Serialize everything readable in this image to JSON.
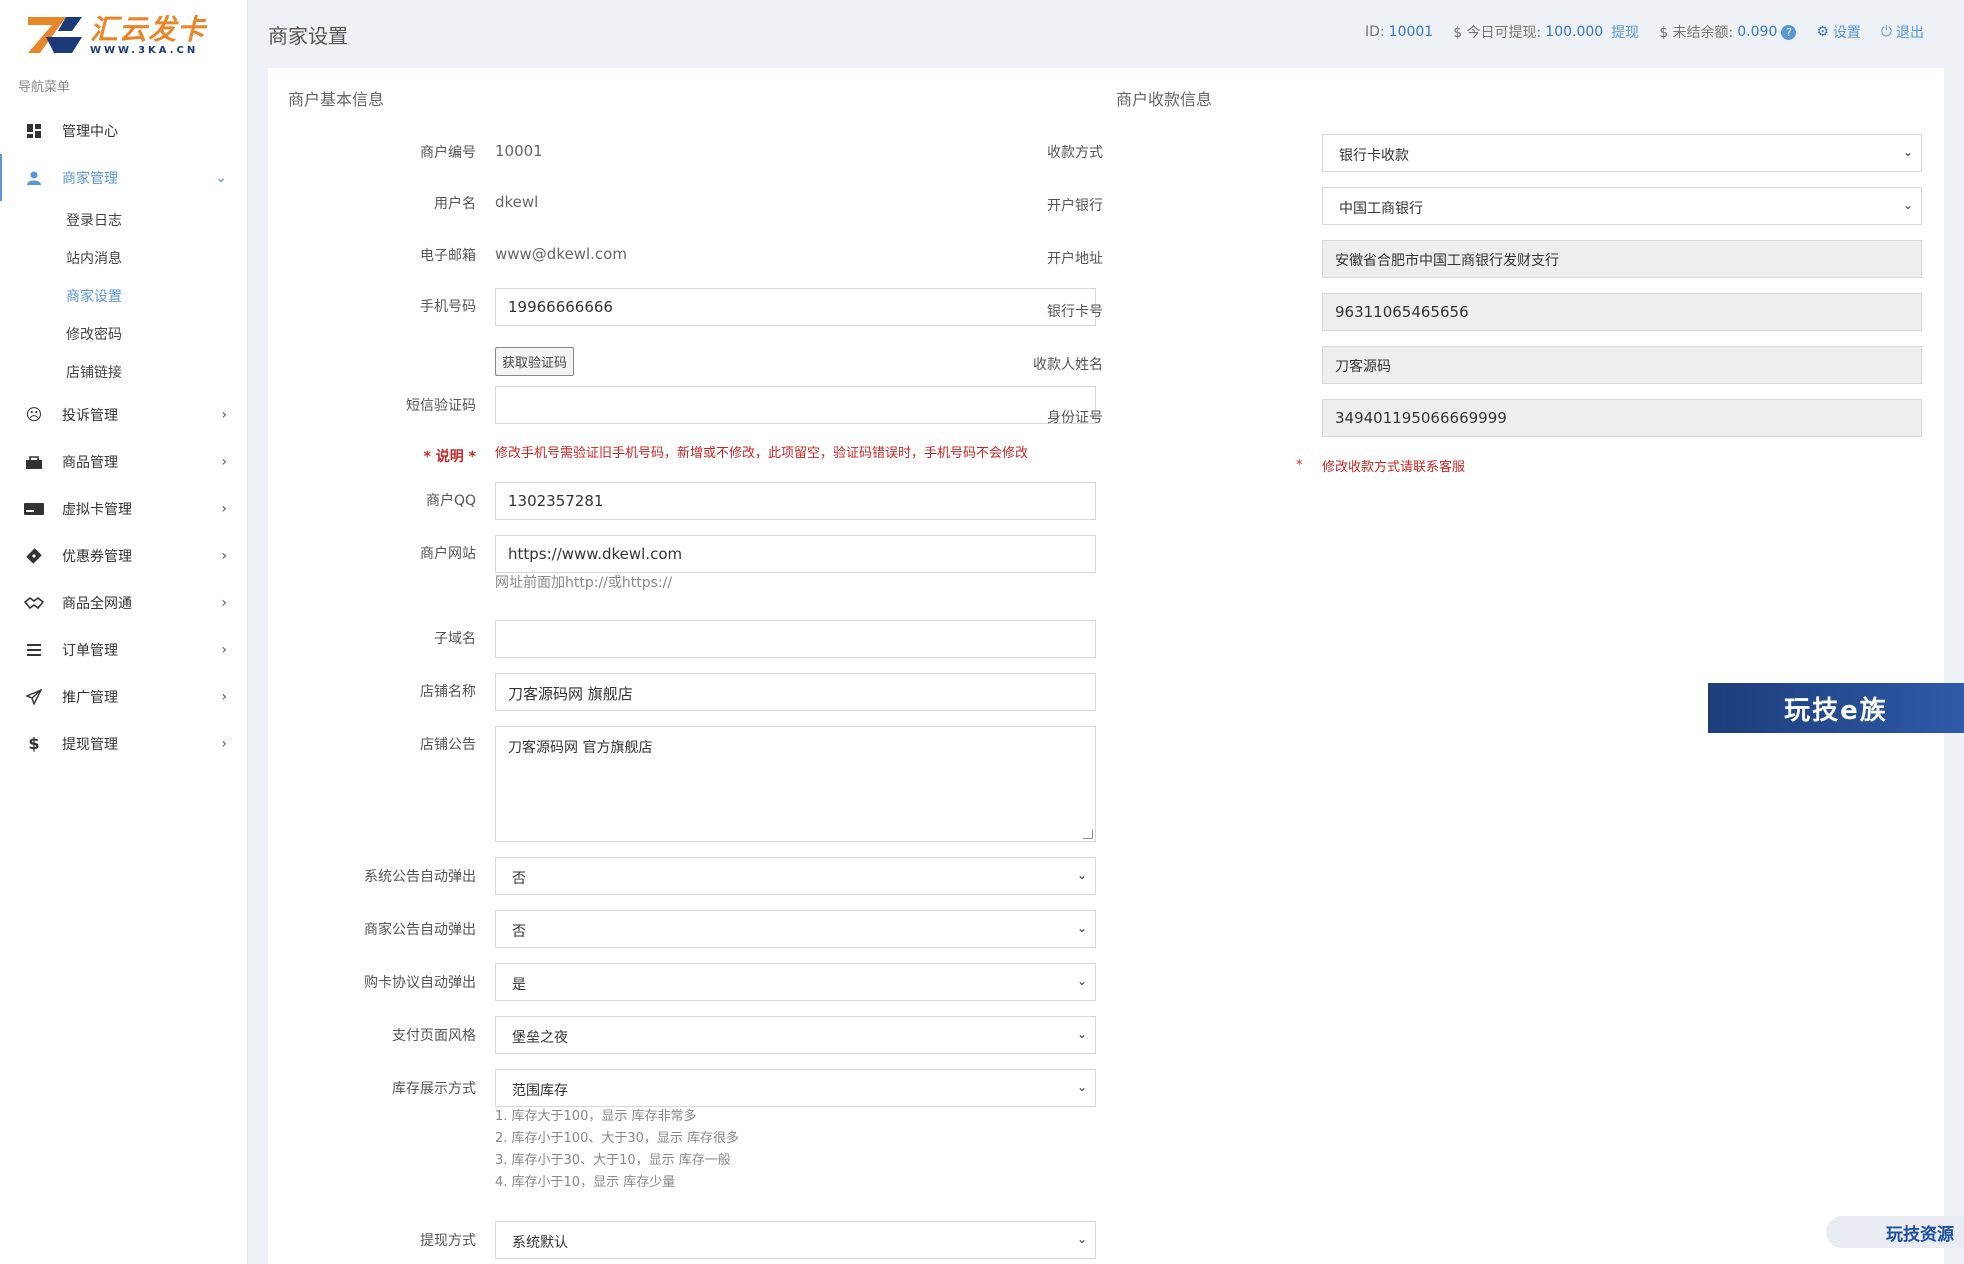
{
  "brand": {
    "title": "汇云发卡",
    "subtitle": "WWW.3KA.CN"
  },
  "sidebar": {
    "caption": "导航菜单",
    "items": [
      {
        "label": "管理中心",
        "icon": "dashboard-icon"
      },
      {
        "label": "商家管理",
        "icon": "user-icon",
        "active": true
      },
      {
        "label": "投诉管理",
        "icon": "frown-icon"
      },
      {
        "label": "商品管理",
        "icon": "bag-icon"
      },
      {
        "label": "虚拟卡管理",
        "icon": "card-icon"
      },
      {
        "label": "优惠券管理",
        "icon": "ticket-icon"
      },
      {
        "label": "商品全网通",
        "icon": "handshake-icon"
      },
      {
        "label": "订单管理",
        "icon": "list-icon"
      },
      {
        "label": "推广管理",
        "icon": "send-icon"
      },
      {
        "label": "提现管理",
        "icon": "dollar-icon"
      }
    ],
    "subitems": [
      "登录日志",
      "站内消息",
      "商家设置",
      "修改密码",
      "店铺链接"
    ]
  },
  "header": {
    "page_title": "商家设置",
    "id_label": "ID:",
    "id_value": "10001",
    "withdrawable_label": "$ 今日可提现:",
    "withdrawable_value": "100.000",
    "withdraw_link": "提现",
    "unsettled_label": "$ 未结余额:",
    "unsettled_value": "0.090",
    "settings_link": "设置",
    "logout_link": "退出"
  },
  "basic": {
    "section_title": "商户基本信息",
    "merchant_no_label": "商户编号",
    "merchant_no": "10001",
    "username_label": "用户名",
    "username": "dkewl",
    "email_label": "电子邮箱",
    "email": "www@dkewl.com",
    "phone_label": "手机号码",
    "phone": "19966666666",
    "get_code_button": "获取验证码",
    "sms_label": "短信验证码",
    "sms": "",
    "note_label": "* 说明 *",
    "note_text": "修改手机号需验证旧手机号码，新增或不修改，此项留空，验证码错误时，手机号码不会修改",
    "qq_label": "商户QQ",
    "qq": "1302357281",
    "website_label": "商户网站",
    "website": "https://www.dkewl.com",
    "website_help": "网址前面加http://或https://",
    "subdomain_label": "子域名",
    "subdomain": "",
    "shop_name_label": "店铺名称",
    "shop_name": "刀客源码网 旗舰店",
    "shop_notice_label": "店铺公告",
    "shop_notice": "刀客源码网  官方旗舰店",
    "sys_popup_label": "系统公告自动弹出",
    "sys_popup": "否",
    "merchant_popup_label": "商家公告自动弹出",
    "merchant_popup": "否",
    "agreement_popup_label": "购卡协议自动弹出",
    "agreement_popup": "是",
    "pay_style_label": "支付页面风格",
    "pay_style": "堡垒之夜",
    "stock_display_label": "库存展示方式",
    "stock_display": "范围库存",
    "stock_help": [
      "1. 库存大于100，显示 库存非常多",
      "2. 库存小于100、大于30，显示 库存很多",
      "3. 库存小于30、大于10，显示 库存一般",
      "4. 库存小于10，显示 库存少量"
    ],
    "withdraw_method_label": "提现方式",
    "withdraw_method": "系统默认"
  },
  "payee": {
    "section_title": "商户收款信息",
    "method_label": "收款方式",
    "method": "银行卡收款",
    "bank_label": "开户银行",
    "bank": "中国工商银行",
    "address_label": "开户地址",
    "address": "安徽省合肥市中国工商银行发财支行",
    "card_label": "银行卡号",
    "card": "96311065465656",
    "name_label": "收款人姓名",
    "name": "刀客源码",
    "id_label": "身份证号",
    "id_no": "349401195066669999",
    "note_star": "*",
    "note": "修改收款方式请联系客服"
  },
  "watermarks": {
    "wz": "玩技e族",
    "res": "玩技资源"
  },
  "colors": {
    "accent": "#5b97d2",
    "danger": "#c62828",
    "brand_orange": "#e8862a",
    "brand_blue": "#1b3a7a"
  }
}
